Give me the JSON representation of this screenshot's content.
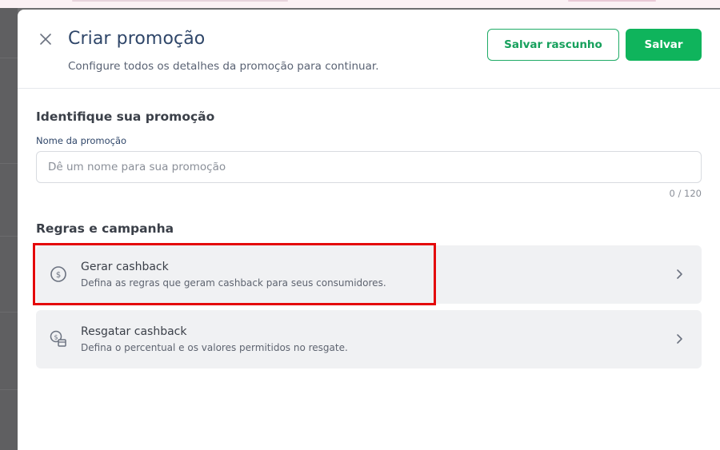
{
  "modal": {
    "title": "Criar promoção",
    "subtitle": "Configure todos os detalhes da promoção para continuar.",
    "draft_button": "Salvar rascunho",
    "save_button": "Salvar"
  },
  "identify": {
    "section_title": "Identifique sua promoção",
    "field_label": "Nome da promoção",
    "placeholder": "Dê um nome para sua promoção",
    "value": "",
    "counter": "0 / 120"
  },
  "rules": {
    "section_title": "Regras e campanha",
    "cards": [
      {
        "title": "Gerar cashback",
        "description": "Defina as regras que geram cashback para seus consumidores.",
        "icon": "dollar-circle-icon"
      },
      {
        "title": "Resgatar cashback",
        "description": "Defina o percentual e os valores permitidos no resgate.",
        "icon": "coins-wallet-icon"
      }
    ]
  },
  "colors": {
    "primary_green": "#0fb45c",
    "title_navy": "#2f4669",
    "highlight_red": "#e4080a",
    "card_bg": "#f0f1f3"
  }
}
